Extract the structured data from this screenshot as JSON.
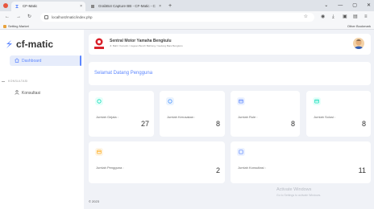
{
  "browser": {
    "tabs": [
      {
        "label": "CF-Matic"
      },
      {
        "label": "GrabBot Capture BB - CF-Matic - C"
      }
    ],
    "url": "localhost/matic/index.php",
    "bookmark": "Setting Market",
    "other_bookmarks": "Other Bookmark"
  },
  "sidebar": {
    "brand": "cf-matic",
    "menu": [
      {
        "label": "Dashboard",
        "active": true
      },
      {
        "label": "Konsultasi",
        "active": false
      }
    ],
    "section_label": "KONSULTASI"
  },
  "header": {
    "title": "Sentral Motor Yamaha Bengkulu",
    "subtitle": "Jl. Bahri Yusrudin / Jagoan Bench Bahlung / Gedong Bara Bengkulu"
  },
  "welcome": "Selamat Datang Pengguna",
  "stats": [
    {
      "label": "Jumlah Gejala :",
      "value": "27",
      "color": "#13deb9",
      "bg": "#e6fffa",
      "icon": "circle-icon"
    },
    {
      "label": "Jumlah Kerusakan :",
      "value": "8",
      "color": "#539bff",
      "bg": "#ebf3fe",
      "icon": "circle-icon"
    },
    {
      "label": "Jumlah Rule :",
      "value": "8",
      "color": "#5d87ff",
      "bg": "#ecf2ff",
      "icon": "card-icon"
    },
    {
      "label": "Jumlah Solusi :",
      "value": "8",
      "color": "#13deb9",
      "bg": "#e6fffa",
      "icon": "card-icon"
    },
    {
      "label": "Jumlah Pengguna :",
      "value": "2",
      "color": "#ffae1f",
      "bg": "#fef5e5",
      "icon": "card-icon"
    },
    {
      "label": "Jumlah Konsultasi :",
      "value": "11",
      "color": "#5d87ff",
      "bg": "#ecf2ff",
      "icon": "square-icon"
    }
  ],
  "footer": "© 2023",
  "watermark": {
    "title": "Activate Windows",
    "subtitle": "Go to Settings to activate Windows."
  }
}
